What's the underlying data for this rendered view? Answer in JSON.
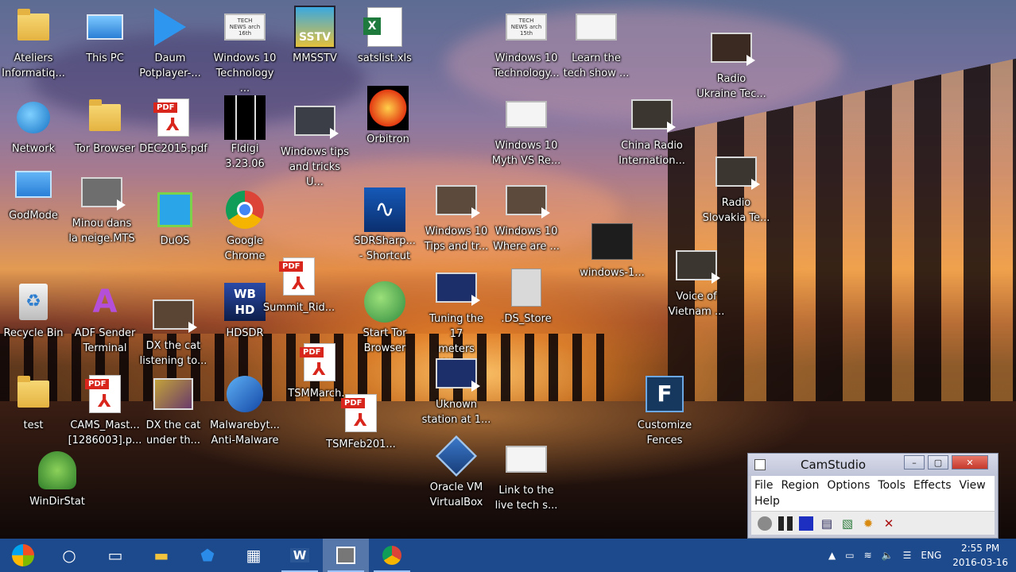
{
  "desktop": {
    "icons": [
      {
        "key": "ateliers",
        "label": "Ateliers\nInformatiq..."
      },
      {
        "key": "thispc",
        "label": "This PC"
      },
      {
        "key": "daum",
        "label": "Daum\nPotplayer-..."
      },
      {
        "key": "win10tech1",
        "label": "Windows 10\nTechnology ...",
        "thumb": "TECH NEWS\narch 16th"
      },
      {
        "key": "mmsstv",
        "label": "MMSSTV",
        "thumb": "SSTV"
      },
      {
        "key": "satslist",
        "label": "satslist.xls"
      },
      {
        "key": "win10tech2",
        "label": "Windows 10\nTechnology...",
        "thumb": "TECH NEWS\narch 15th"
      },
      {
        "key": "learnshow",
        "label": "Learn the\ntech show ..."
      },
      {
        "key": "radioukraine",
        "label": "Radio\nUkraine Tec..."
      },
      {
        "key": "network",
        "label": "Network"
      },
      {
        "key": "tor",
        "label": "Tor Browser"
      },
      {
        "key": "dec2015",
        "label": "DEC2015.pdf"
      },
      {
        "key": "fldigi",
        "label": "Fldigi 3.23.06"
      },
      {
        "key": "wintips",
        "label": "Windows tips\nand tricks U..."
      },
      {
        "key": "orbitron",
        "label": "Orbitron"
      },
      {
        "key": "win10myth",
        "label": "Windows 10\nMyth VS Re..."
      },
      {
        "key": "chinaradio",
        "label": "China Radio\nInternation..."
      },
      {
        "key": "radioslovakia",
        "label": "Radio\nSlovakia Te..."
      },
      {
        "key": "godmode",
        "label": "GodMode"
      },
      {
        "key": "minou",
        "label": "Minou dans\nla neige.MTS"
      },
      {
        "key": "duos",
        "label": "DuOS"
      },
      {
        "key": "chrome",
        "label": "Google\nChrome"
      },
      {
        "key": "sdrsharp",
        "label": "SDRSharp...\n- Shortcut"
      },
      {
        "key": "win10tips",
        "label": "Windows 10\nTips and tr..."
      },
      {
        "key": "win10where",
        "label": "Windows 10\nWhere are ..."
      },
      {
        "key": "windows1",
        "label": "windows-1..."
      },
      {
        "key": "voicevietnam",
        "label": "Voice of\nVietnam ..."
      },
      {
        "key": "recycle",
        "label": "Recycle Bin"
      },
      {
        "key": "adf",
        "label": "ADF Sender\nTerminal"
      },
      {
        "key": "dxlistening",
        "label": "DX the cat\nlistening to..."
      },
      {
        "key": "hdsdr",
        "label": "HDSDR"
      },
      {
        "key": "summit",
        "label": "Summit_Rid..."
      },
      {
        "key": "starttor",
        "label": "Start Tor\nBrowser"
      },
      {
        "key": "tuning",
        "label": "Tuning the 17\nmeters WAR..."
      },
      {
        "key": "dsstore",
        "label": ".DS_Store"
      },
      {
        "key": "test",
        "label": "test"
      },
      {
        "key": "cams",
        "label": "CAMS_Mast...\n[1286003].p..."
      },
      {
        "key": "dxunder",
        "label": "DX the cat\nunder th..."
      },
      {
        "key": "malwarebytes",
        "label": "Malwarebyt...\nAnti-Malware"
      },
      {
        "key": "tsmmarch",
        "label": "TSMMarch..."
      },
      {
        "key": "tsmfeb",
        "label": "TSMFeb201..."
      },
      {
        "key": "uknown",
        "label": "Uknown\nstation at 1..."
      },
      {
        "key": "fences",
        "label": "Customize\nFences"
      },
      {
        "key": "windirstat",
        "label": "WinDirStat"
      },
      {
        "key": "virtualbox",
        "label": "Oracle VM\nVirtualBox"
      },
      {
        "key": "linklive",
        "label": "Link to the\nlive tech s..."
      }
    ],
    "pdf_tag": "PDF",
    "hdsdr_badge": "WB\nHD"
  },
  "camstudio": {
    "title": "CamStudio",
    "menu": [
      "File",
      "Region",
      "Options",
      "Tools",
      "Effects",
      "View"
    ],
    "menu2": [
      "Help"
    ],
    "controls": {
      "minimize": "–",
      "maximize": "▢",
      "close": "✕"
    }
  },
  "taskbar": {
    "lang": "ENG",
    "time": "2:55 PM",
    "date": "2016-03-16"
  }
}
